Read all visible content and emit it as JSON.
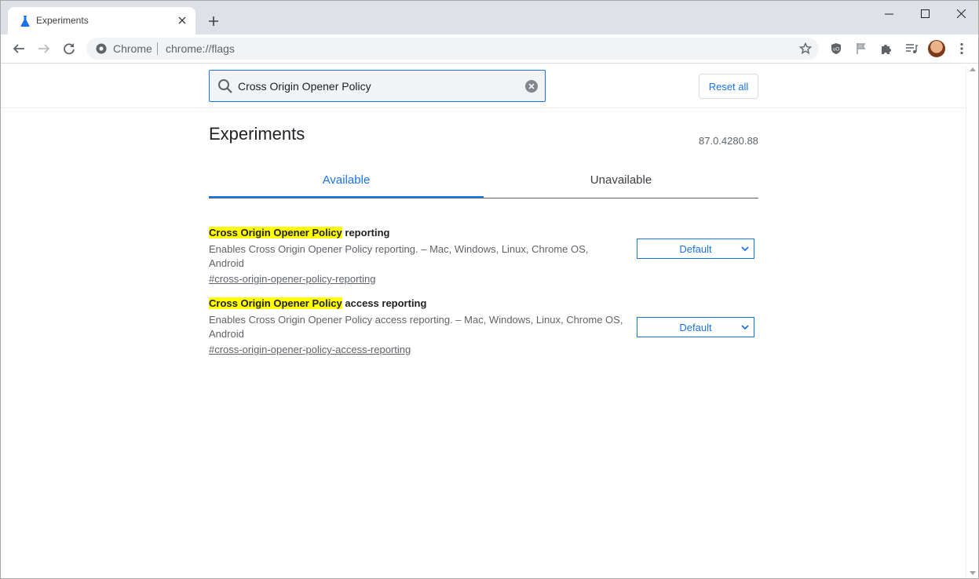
{
  "browser": {
    "tab_title": "Experiments",
    "omnibox_chip": "Chrome",
    "url": "chrome://flags",
    "icons": [
      "flask-icon",
      "close-icon",
      "plus-icon",
      "minimize-icon",
      "maximize-icon",
      "window-close-icon",
      "back-icon",
      "forward-icon",
      "reload-icon",
      "chrome-icon",
      "star-icon",
      "ublock-icon",
      "flag-icon",
      "extensions-icon",
      "media-icon",
      "avatar",
      "more-icon"
    ]
  },
  "header": {
    "search_value": "Cross Origin Opener Policy",
    "reset_label": "Reset all"
  },
  "page": {
    "title": "Experiments",
    "version": "87.0.4280.88",
    "tabs": [
      {
        "label": "Available",
        "active": true
      },
      {
        "label": "Unavailable",
        "active": false
      }
    ]
  },
  "experiments": [
    {
      "highlight": "Cross Origin Opener Policy",
      "name_rest": " reporting",
      "description": "Enables Cross Origin Opener Policy reporting. – Mac, Windows, Linux, Chrome OS, Android",
      "link": "#cross-origin-opener-policy-reporting",
      "select_value": "Default"
    },
    {
      "highlight": "Cross Origin Opener Policy",
      "name_rest": " access reporting",
      "description": "Enables Cross Origin Opener Policy access reporting. – Mac, Windows, Linux, Chrome OS, Android",
      "link": "#cross-origin-opener-policy-access-reporting",
      "select_value": "Default"
    }
  ],
  "colors": {
    "accent": "#1a73e8",
    "highlight": "#ffff00",
    "tabstrip": "#dee1e6"
  }
}
